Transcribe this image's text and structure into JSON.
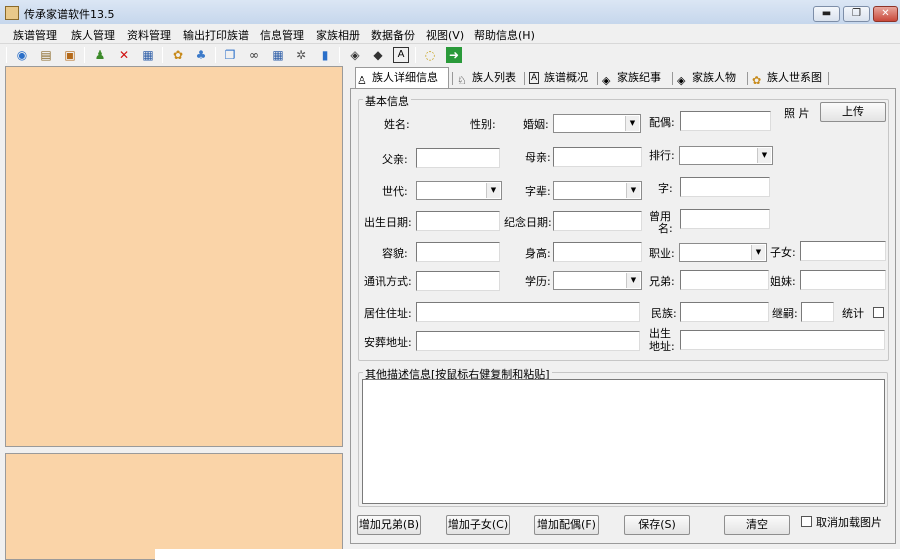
{
  "window": {
    "title": "传承家谱软件13.5",
    "minimize": "▬",
    "restore": "❐",
    "close": "✕"
  },
  "menu": [
    {
      "label": "族谱管理"
    },
    {
      "label": "族人管理"
    },
    {
      "label": "资料管理"
    },
    {
      "label": "输出打印族谱"
    },
    {
      "label": "信息管理"
    },
    {
      "label": "家族相册"
    },
    {
      "label": "数据备份"
    },
    {
      "label": "视图(V)"
    },
    {
      "label": "帮助信息(H)"
    }
  ],
  "toolbar_icons": [
    "globe-icon",
    "book-icon",
    "photo-icon",
    "add-person-icon",
    "delete-icon",
    "card-icon",
    "people-icon",
    "group-icon",
    "copy-icon",
    "binoculars-icon",
    "grid-icon",
    "gear-icon",
    "chart-icon",
    "eye-icon",
    "books-icon",
    "font-icon",
    "chat-icon",
    "exit-icon"
  ],
  "tabs": [
    {
      "label": "族人详细信息",
      "icon": "person-icon"
    },
    {
      "label": "族人列表",
      "icon": "person-list-icon"
    },
    {
      "label": "族谱概况",
      "icon": "font-icon"
    },
    {
      "label": "家族纪事",
      "icon": "eye-icon"
    },
    {
      "label": "家族人物",
      "icon": "eye-icon"
    },
    {
      "label": "族人世系图",
      "icon": "people-icon"
    }
  ],
  "basic": {
    "legend": "基本信息",
    "photo_label": "照  片",
    "upload": "上传",
    "name": "姓名:",
    "gender": "性别:",
    "marriage": "婚姻:",
    "spouse": "配偶:",
    "father": "父亲:",
    "mother": "母亲:",
    "rank": "排行:",
    "generation": "世代:",
    "generation_char": "字辈:",
    "courtesy": "字:",
    "birth_date": "出生日期:",
    "memorial_date": "纪念日期:",
    "former_name_1": "曾用",
    "former_name_2": "名:",
    "appearance": "容貌:",
    "height": "身高:",
    "occupation": "职业:",
    "children": "子女:",
    "contact": "通讯方式:",
    "education": "学历:",
    "brothers": "兄弟:",
    "sisters": "姐妹:",
    "residence": "居住住址:",
    "ethnicity": "民族:",
    "adoption": "继嗣:",
    "stats": "统计",
    "burial": "安葬地址:",
    "birthplace_1": "出生",
    "birthplace_2": "地址:"
  },
  "other": {
    "legend": "其他描述信息[按鼠标右健复制和粘贴]"
  },
  "buttons": {
    "add_brother": "增加兄弟(B)",
    "add_child": "增加子女(C)",
    "add_spouse": "增加配偶(F)",
    "save": "保存(S)",
    "clear": "清空",
    "cancel_photo": "取消加载图片"
  },
  "colors": {
    "pane": "#fad4a8",
    "titlebar": "#c5d6ec",
    "close": "#c9483a"
  }
}
